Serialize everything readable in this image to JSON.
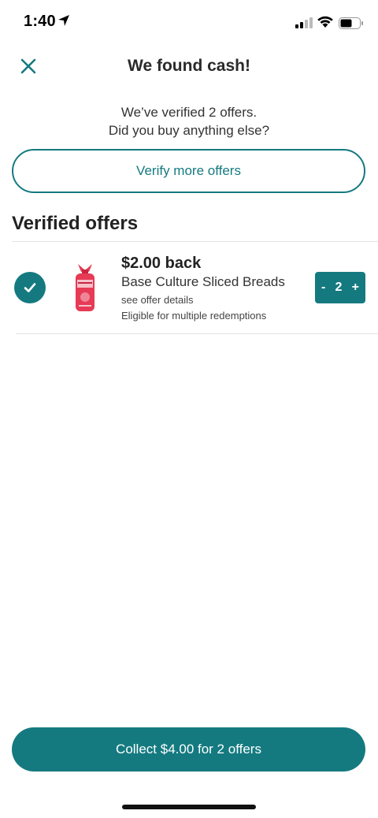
{
  "status_bar": {
    "time": "1:40"
  },
  "header": {
    "title": "We found cash!",
    "close_icon": "close-icon"
  },
  "summary": {
    "line1": "We’ve verified 2 offers.",
    "line2": "Did you buy anything else?"
  },
  "verify_more_label": "Verify more offers",
  "verified_section": {
    "heading": "Verified offers",
    "offers": [
      {
        "amount": "$2.00 back",
        "name": "Base Culture Sliced Breads",
        "details_link": "see offer details",
        "eligibility": "Eligible for multiple redemptions",
        "quantity": "2",
        "minus": "-",
        "plus": "+",
        "verified": true
      }
    ]
  },
  "collect_button": "Collect $4.00 for 2 offers",
  "colors": {
    "accent": "#147a80",
    "product_red": "#e63a55"
  }
}
